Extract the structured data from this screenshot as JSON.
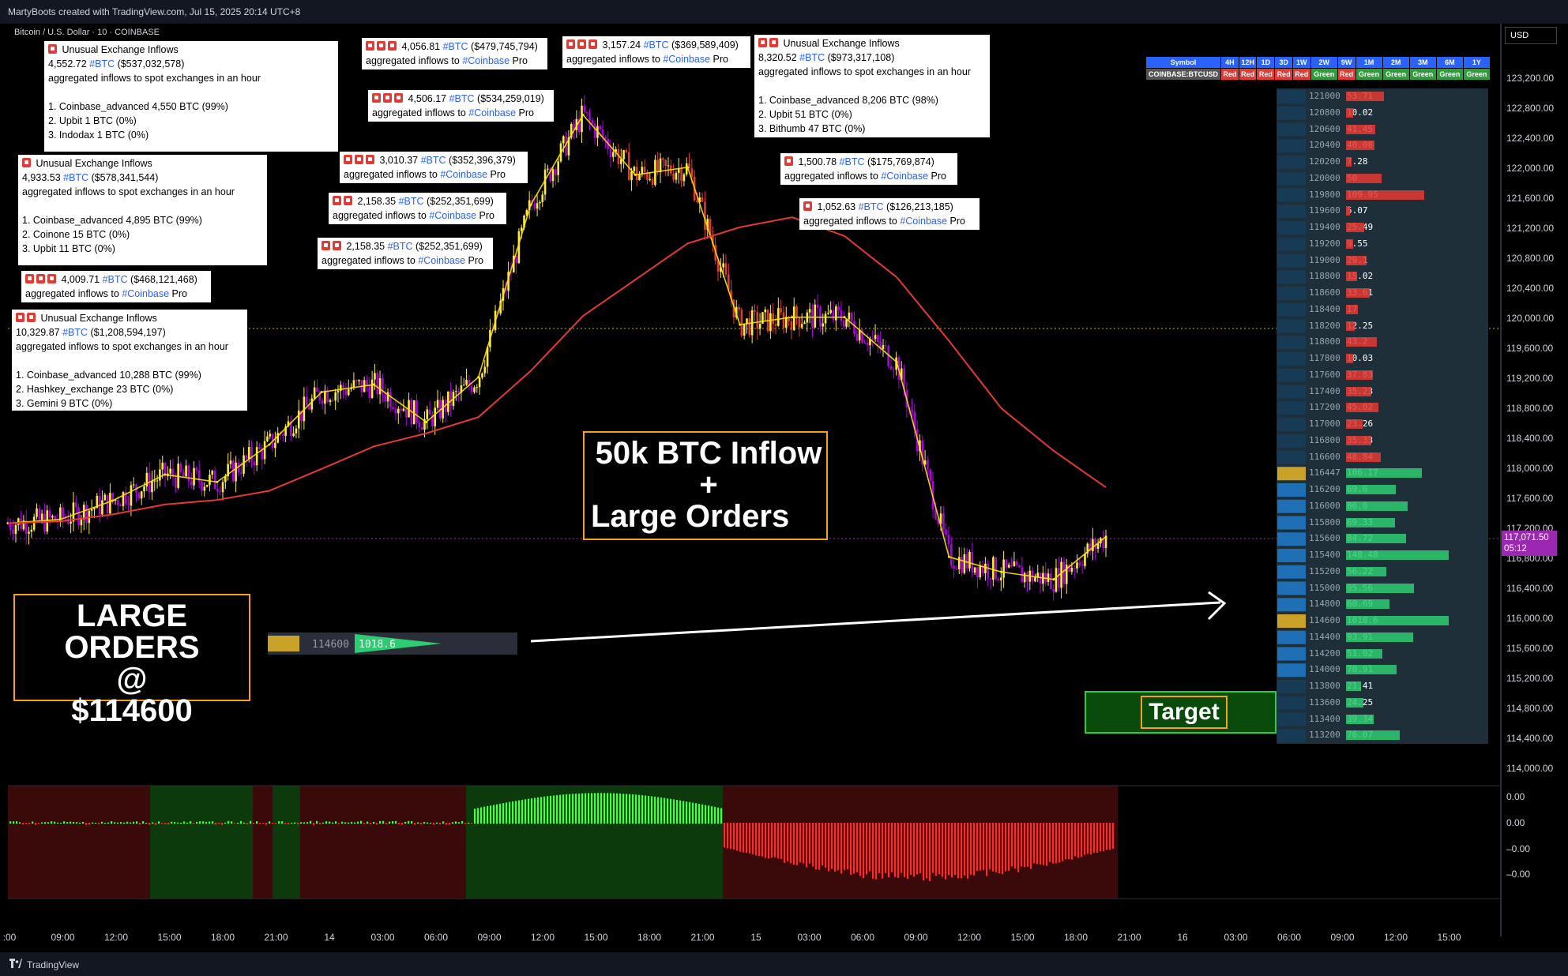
{
  "header": {
    "credit": "MartyBoots created with TradingView.com, Jul 15, 2025 20:14 UTC+8"
  },
  "symbol_title": "Bitcoin / U.S. Dollar · 10 · COINBASE",
  "currency": "USD",
  "footer": {
    "brand": "TradingView"
  },
  "colors": {
    "up": "#ffeb3b",
    "down_purple": "#b000e6",
    "ema_fast": "#ffe600",
    "ema_mid": "#fff176",
    "ema_red": "#e53935",
    "ema_gray": "#9e9e9e",
    "ema_purple": "#c13bff",
    "hist_up": "#44ff44",
    "hist_down": "#ff2a2a"
  },
  "notes": [
    {
      "icons": 1,
      "title": "Unusual Exchange Inflows",
      "amount": "4,552.72",
      "btc": "#BTC",
      "usd": "($537,032,578)",
      "lines": [
        "aggregated inflows to spot exchanges in an hour",
        "",
        "1. Coinbase_advanced 4,550 BTC (99%)",
        "2. Upbit 1 BTC (0%)",
        "3. Indodax 1 BTC (0%)"
      ]
    },
    {
      "icons": 1,
      "title": "Unusual Exchange Inflows",
      "amount": "4,933.53",
      "btc": "#BTC",
      "usd": "($578,341,544)",
      "lines": [
        "aggregated inflows to spot exchanges in an hour",
        "",
        "1. Coinbase_advanced 4,895 BTC (99%)",
        "2. Coinone 15 BTC (0%)",
        "3. Upbit 11 BTC (0%)"
      ]
    },
    {
      "icons": 3,
      "amount": "4,009.71",
      "btc": "#BTC",
      "usd": "($468,121,468)",
      "pro": "aggregated inflows to",
      "cb": "#Coinbase",
      "suffix": "Pro"
    },
    {
      "icons": 2,
      "title": "Unusual Exchange Inflows",
      "amount": "10,329.87",
      "btc": "#BTC",
      "usd": "($1,208,594,197)",
      "lines": [
        "aggregated inflows to spot exchanges in an hour",
        "",
        "1. Coinbase_advanced 10,288 BTC (99%)",
        "2. Hashkey_exchange 23 BTC (0%)",
        "3. Gemini 9 BTC (0%)"
      ]
    },
    {
      "icons": 3,
      "amount": "4,056.81",
      "btc": "#BTC",
      "usd": "($479,745,794)",
      "pro": "aggregated inflows to",
      "cb": "#Coinbase",
      "suffix": "Pro"
    },
    {
      "icons": 3,
      "amount": "4,506.17",
      "btc": "#BTC",
      "usd": "($534,259,019)",
      "pro": "aggregated inflows to",
      "cb": "#Coinbase",
      "suffix": "Pro"
    },
    {
      "icons": 3,
      "amount": "3,010.37",
      "btc": "#BTC",
      "usd": "($352,396,379)",
      "pro": "aggregated inflows to",
      "cb": "#Coinbase",
      "suffix": "Pro"
    },
    {
      "icons": 2,
      "amount": "2,158.35",
      "btc": "#BTC",
      "usd": "($252,351,699)",
      "pro": "aggregated inflows to",
      "cb": "#Coinbase",
      "suffix": "Pro"
    },
    {
      "icons": 2,
      "amount": "2,158.35",
      "btc": "#BTC",
      "usd": "($252,351,699)",
      "pro": "aggregated inflows to",
      "cb": "#Coinbase",
      "suffix": "Pro"
    },
    {
      "icons": 3,
      "amount": "3,157.24",
      "btc": "#BTC",
      "usd": "($369,589,409)",
      "pro": "aggregated inflows to",
      "cb": "#Coinbase",
      "suffix": "Pro"
    },
    {
      "icons": 2,
      "title": "Unusual Exchange Inflows",
      "amount": "8,320.52",
      "btc": "#BTC",
      "usd": "($973,317,108)",
      "lines": [
        "aggregated inflows to spot exchanges in an hour",
        "",
        "1. Coinbase_advanced 8,206 BTC (98%)",
        "2. Upbit 51 BTC (0%)",
        "3. Bithumb 47 BTC (0%)"
      ]
    },
    {
      "icons": 1,
      "amount": "1,500.78",
      "btc": "#BTC",
      "usd": "($175,769,874)",
      "pro": "aggregated inflows to",
      "cb": "#Coinbase",
      "suffix": "Pro"
    },
    {
      "icons": 1,
      "amount": "1,052.63",
      "btc": "#BTC",
      "usd": "($126,213,185)",
      "pro": "aggregated inflows to",
      "cb": "#Coinbase",
      "suffix": "Pro"
    }
  ],
  "callouts": {
    "inflow": [
      "50k BTC Inflow",
      "+",
      "Large Orders"
    ],
    "large": [
      "LARGE ORDERS",
      "@",
      "$114600"
    ],
    "target": "Target"
  },
  "mini_profile": {
    "price": "114600",
    "value": "1018.6"
  },
  "tf_table": {
    "headers": [
      "Symbol",
      "4H",
      "12H",
      "1D",
      "3D",
      "1W",
      "2W",
      "9W",
      "1M",
      "2M",
      "3M",
      "6M",
      "1Y"
    ],
    "row": [
      "COINBASE:BTCUSD",
      "Red",
      "Red",
      "Red",
      "Red",
      "Red",
      "Green",
      "Red",
      "Green",
      "Green",
      "Green",
      "Green",
      "Green"
    ]
  },
  "dom": [
    [
      "121000",
      "53.71"
    ],
    [
      "120800",
      "10.02"
    ],
    [
      "120600",
      "41.45"
    ],
    [
      "120400",
      "40.08"
    ],
    [
      "120200",
      "7.28"
    ],
    [
      "120000",
      "50"
    ],
    [
      "119800",
      "109.95"
    ],
    [
      "119600",
      "5.07"
    ],
    [
      "119400",
      "25.49"
    ],
    [
      "119200",
      "9.55"
    ],
    [
      "119000",
      "29.1"
    ],
    [
      "118800",
      "15.02"
    ],
    [
      "118600",
      "33.61"
    ],
    [
      "118400",
      "17"
    ],
    [
      "118200",
      "12.25"
    ],
    [
      "118000",
      "43.2"
    ],
    [
      "117800",
      "10.03"
    ],
    [
      "117600",
      "37.83"
    ],
    [
      "117400",
      "35.23"
    ],
    [
      "117200",
      "45.02"
    ],
    [
      "117000",
      "23.26"
    ],
    [
      "116800",
      "35.33"
    ],
    [
      "116600",
      "48.84"
    ],
    [
      "116447",
      "106.17"
    ],
    [
      "116200",
      "69.6"
    ],
    [
      "116000",
      "86.6"
    ],
    [
      "115800",
      "69.33"
    ],
    [
      "115600",
      "84.72"
    ],
    [
      "115400",
      "148.48"
    ],
    [
      "115200",
      "56.22"
    ],
    [
      "115000",
      "95.56"
    ],
    [
      "114800",
      "60.69"
    ],
    [
      "114600",
      "1018.6"
    ],
    [
      "114400",
      "93.91"
    ],
    [
      "114200",
      "51.02"
    ],
    [
      "114000",
      "70.91"
    ],
    [
      "113800",
      "21.41"
    ],
    [
      "113600",
      "24.25"
    ],
    [
      "113400",
      "39.34"
    ],
    [
      "113200",
      "76.07"
    ]
  ],
  "price_axis": [
    "123,200.00",
    "122,800.00",
    "122,400.00",
    "122,000.00",
    "121,600.00",
    "121,200.00",
    "120,800.00",
    "120,400.00",
    "120,000.00",
    "119,600.00",
    "119,200.00",
    "118,800.00",
    "118,400.00",
    "118,000.00",
    "117,600.00",
    "117,200.00",
    "116,800.00",
    "116,400.00",
    "116,000.00",
    "115,600.00",
    "115,200.00",
    "114,800.00",
    "114,400.00",
    "114,000.00"
  ],
  "last_price": {
    "price": "117,071.50",
    "countdown": "05:12"
  },
  "osc_axis": [
    "0.00",
    "0.00",
    "–0.00",
    "–0.00"
  ],
  "time_axis": [
    ":00",
    "09:00",
    "12:00",
    "15:00",
    "18:00",
    "21:00",
    "14",
    "03:00",
    "06:00",
    "09:00",
    "12:00",
    "15:00",
    "18:00",
    "21:00",
    "15",
    "03:00",
    "06:00",
    "09:00",
    "12:00",
    "15:00",
    "18:00",
    "21:00",
    "16",
    "03:00",
    "06:00",
    "09:00",
    "12:00",
    "15:00"
  ],
  "chart_data": {
    "type": "line",
    "title": "Bitcoin / U.S. Dollar · 10 · COINBASE",
    "xlabel": "",
    "ylabel": "",
    "ylim": [
      114000,
      123300
    ],
    "x": [
      "13 06:00",
      "13 09:00",
      "13 12:00",
      "13 15:00",
      "13 18:00",
      "13 21:00",
      "14 00:00",
      "14 03:00",
      "14 06:00",
      "14 09:00",
      "14 12:00",
      "14 15:00",
      "14 18:00",
      "14 21:00",
      "15 00:00",
      "15 03:00",
      "15 06:00",
      "15 09:00",
      "15 12:00",
      "15 15:00",
      "15 18:00",
      "15 20:10"
    ],
    "series": [
      {
        "values": [
          117250,
          117300,
          117550,
          117900,
          117800,
          118300,
          119000,
          119100,
          118600,
          119200,
          121500,
          122700,
          121900,
          122000,
          119900,
          120000,
          120000,
          119400,
          116800,
          116600,
          116500,
          117070
        ]
      }
    ]
  }
}
